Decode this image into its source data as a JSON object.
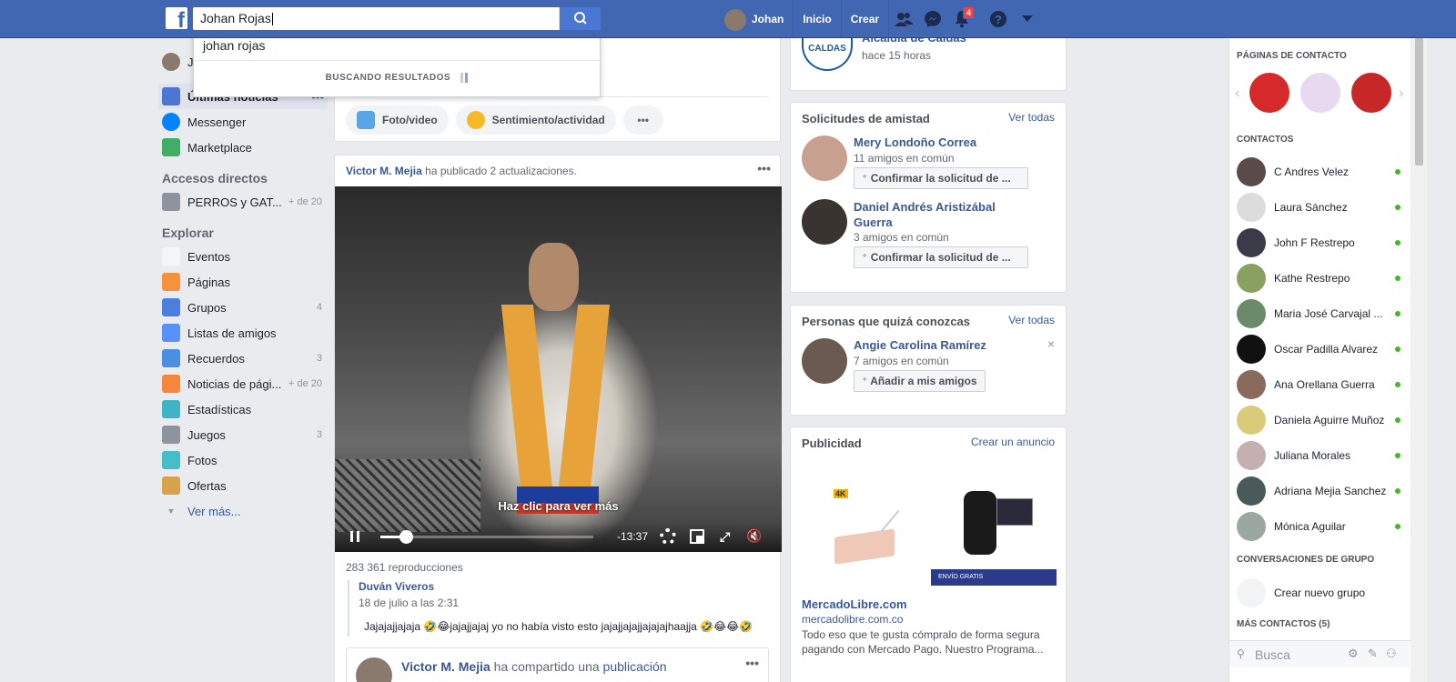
{
  "header": {
    "logo": "f",
    "search_value": "Johan Rojas",
    "user_name": "Johan",
    "nav": [
      "Inicio",
      "Crear"
    ],
    "notif_count": "4"
  },
  "search_dropdown": {
    "suggestion": "johan rojas",
    "searching": "BUSCANDO RESULTADOS"
  },
  "left_nav": {
    "user_initial": "J",
    "news_feed": "Últimas noticias",
    "items_top": [
      {
        "label": "Messenger"
      },
      {
        "label": "Marketplace"
      }
    ],
    "shortcuts_title": "Accesos directos",
    "shortcut": {
      "label": "PERROS y GAT...",
      "count": "+ de 20"
    },
    "explore_title": "Explorar",
    "explore": [
      {
        "label": "Eventos",
        "count": "",
        "icon": "calendar-icon",
        "color": "#f5f6f7"
      },
      {
        "label": "Páginas",
        "count": "",
        "icon": "flag-icon",
        "color": "#f7923b"
      },
      {
        "label": "Grupos",
        "count": "4",
        "icon": "groups-icon",
        "color": "#4a7fe0"
      },
      {
        "label": "Listas de amigos",
        "count": "",
        "icon": "friends-list-icon",
        "color": "#5890ff"
      },
      {
        "label": "Recuerdos",
        "count": "3",
        "icon": "clock-icon",
        "color": "#4a90e2"
      },
      {
        "label": "Noticias de pági...",
        "count": "+ de 20",
        "icon": "page-feed-icon",
        "color": "#f5863b"
      },
      {
        "label": "Estadísticas",
        "count": "",
        "icon": "cube-icon",
        "color": "#3fb4c6"
      },
      {
        "label": "Juegos",
        "count": "3",
        "icon": "gamepad-icon",
        "color": "#8d949e"
      },
      {
        "label": "Fotos",
        "count": "",
        "icon": "photos-icon",
        "color": "#44bec7"
      },
      {
        "label": "Ofertas",
        "count": "",
        "icon": "offers-icon",
        "color": "#d8a24a"
      }
    ],
    "see_more": "Ver más..."
  },
  "composer": {
    "photo_video": "Foto/video",
    "feeling": "Sentimiento/actividad",
    "more": "•••"
  },
  "post": {
    "author": "Victor M. Mejia",
    "action": " ha publicado 2 actualizaciones.",
    "video_overlay": "Haz clic para ver más",
    "time_left": "-13:37",
    "progress": 0.12,
    "views": "283 361 reproducciones",
    "sub_author": "Duván Viveros",
    "sub_date": "18 de julio a las 2:31",
    "sub_text": "Jajajajjajaja 🤣😂jajajjajaj yo no había visto esto jajajjajajjajajajhaajja 🤣😂😂🤣",
    "next_author": "Victor M. Mejia",
    "next_action": " ha compartido una ",
    "next_link": "publicación"
  },
  "page_card": {
    "name": "Alcaldía de Caldas",
    "time": "hace 15 horas",
    "logo_text": "CALDAS"
  },
  "friend_requests": {
    "title": "Solicitudes de amistad",
    "see_all": "Ver todas",
    "items": [
      {
        "name": "Mery Londoño Correa",
        "mutual": "11 amigos en común",
        "button": "Confirmar la solicitud de ..."
      },
      {
        "name": "Daniel Andrés Aristizábal Guerra",
        "mutual": "3 amigos en común",
        "button": "Confirmar la solicitud de ..."
      }
    ]
  },
  "pymk": {
    "title": "Personas que quizá conozcas",
    "see_all": "Ver todas",
    "name": "Angie Carolina Ramírez",
    "mutual": "7 amigos en común",
    "button": "Añadir a mis amigos",
    "close": "×"
  },
  "ads": {
    "title": "Publicidad",
    "create": "Crear un anuncio",
    "advertiser": "MercadoLibre.com",
    "domain": "mercadolibre.com.co",
    "text": "Todo eso que te gusta cómpralo de forma segura pagando con Mercado Pago. Nuestro Programa...",
    "badge_4k": "4K",
    "envio": "ENVÍO GRATIS"
  },
  "right_sidebar": {
    "pages_title": "PÁGINAS DE CONTACTO",
    "contacts_title": "CONTACTOS",
    "contacts": [
      {
        "name": "C Andres Velez",
        "color": "#5a4a4a"
      },
      {
        "name": "Laura Sánchez",
        "color": "#dcdcdc"
      },
      {
        "name": "John F Restrepo",
        "color": "#3a3a48"
      },
      {
        "name": "Kathe Restrepo",
        "color": "#8aa060"
      },
      {
        "name": "Maria José Carvajal ...",
        "color": "#6a8a6a"
      },
      {
        "name": "Oscar Padilla Alvarez",
        "color": "#111111"
      },
      {
        "name": "Ana Orellana Guerra",
        "color": "#8a6a5a"
      },
      {
        "name": "Daniela Aguirre Muñoz",
        "color": "#d8cc7a"
      },
      {
        "name": "Juliana Morales",
        "color": "#c4b0b0"
      },
      {
        "name": "Adriana Mejia Sanchez",
        "color": "#4a5a5a"
      },
      {
        "name": "Mónica Aguilar",
        "color": "#9aa8a0"
      }
    ],
    "group_title": "CONVERSACIONES DE GRUPO",
    "create_group": "Crear nuevo grupo",
    "more_contacts": "MÁS CONTACTOS (5)",
    "search_placeholder": "Busca"
  }
}
